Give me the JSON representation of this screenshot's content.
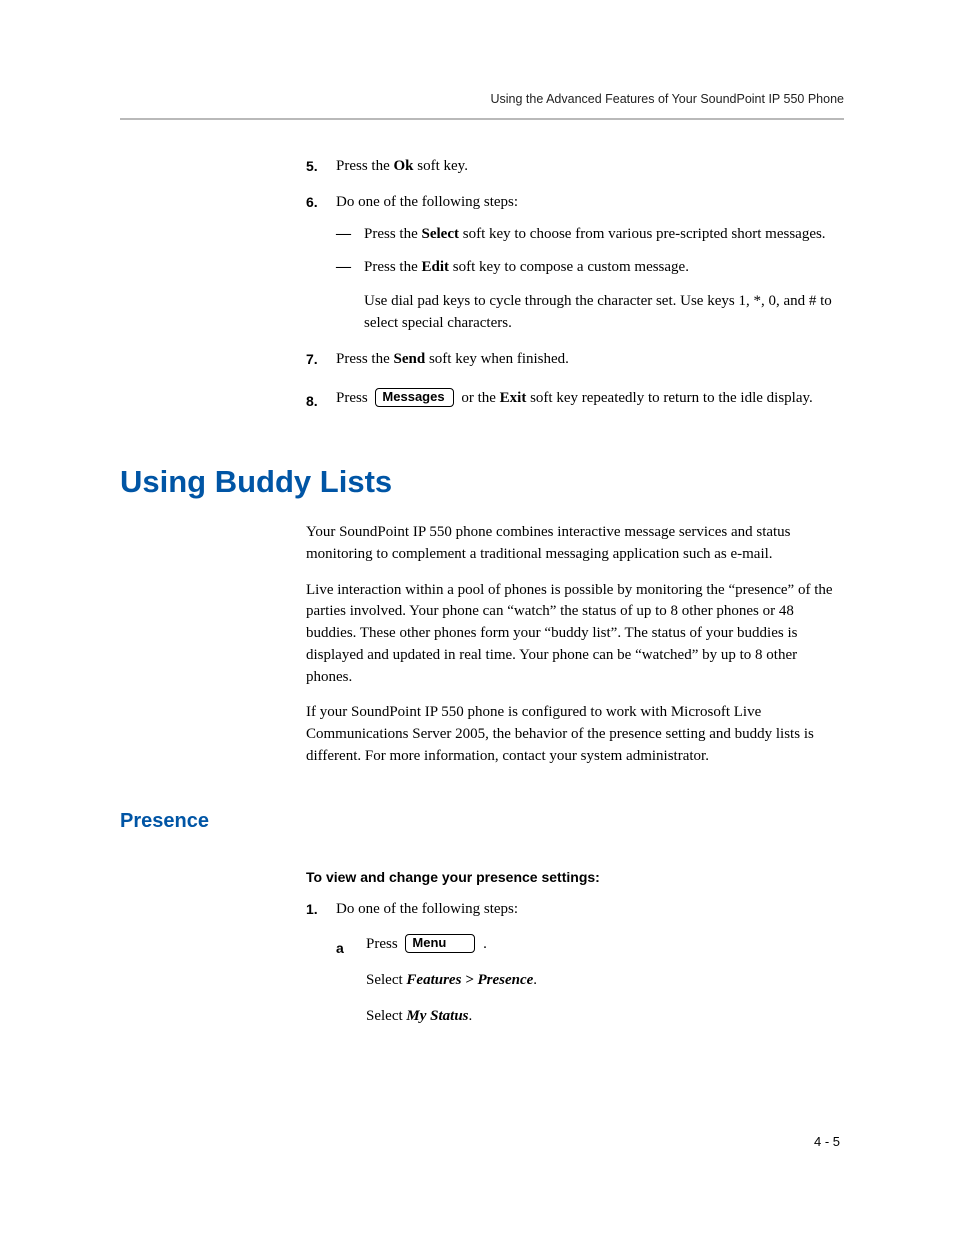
{
  "running_head": "Using the Advanced Features of Your SoundPoint IP 550 Phone",
  "steps": {
    "s5": {
      "num": "5.",
      "before": "Press the ",
      "bold": "Ok",
      "after": " soft key."
    },
    "s6": {
      "num": "6.",
      "lead": "Do one of the following steps:",
      "d1": {
        "before": "Press the ",
        "bold": "Select",
        "after": " soft key to choose from various pre-scripted short messages."
      },
      "d2": {
        "before": "Press the ",
        "bold": "Edit",
        "after": " soft key to compose a custom message."
      },
      "d2_extra": "Use dial pad keys to cycle through the character set. Use keys 1, *, 0, and # to select special characters."
    },
    "s7": {
      "num": "7.",
      "before": "Press the ",
      "bold": "Send",
      "after": " soft key when finished."
    },
    "s8": {
      "num": "8.",
      "before": "Press ",
      "btn": "Messages",
      "mid": " or the ",
      "bold": "Exit",
      "after": " soft key repeatedly to return to the idle display."
    }
  },
  "section": "Using Buddy Lists",
  "paras": {
    "p1": "Your SoundPoint IP 550 phone combines interactive message services and status monitoring to complement a traditional messaging application such as e-mail.",
    "p2": "Live interaction within a pool of phones is possible by monitoring the “presence” of the parties involved. Your phone can “watch” the status of up to 8 other phones or 48 buddies. These other phones form your “buddy list”. The status of your buddies is displayed and updated in real time. Your phone can be “watched” by up to 8 other phones.",
    "p3": "If your SoundPoint IP 550 phone is configured to work with Microsoft Live Communications Server 2005, the behavior of the presence setting and buddy lists is different. For more information, contact your system administrator."
  },
  "subsection": "Presence",
  "task_head": "To view and change your presence settings:",
  "presence_steps": {
    "s1": {
      "num": "1.",
      "lead": "Do one of the following steps:",
      "a": {
        "alpha": "a",
        "before": "Press ",
        "btn": "Menu",
        "after": " .",
        "line2_pre": "Select ",
        "line2_em": "Features > Presence",
        "line2_post": ".",
        "line3_pre": "Select ",
        "line3_em": "My Status",
        "line3_post": "."
      }
    }
  },
  "folio": "4 - 5"
}
